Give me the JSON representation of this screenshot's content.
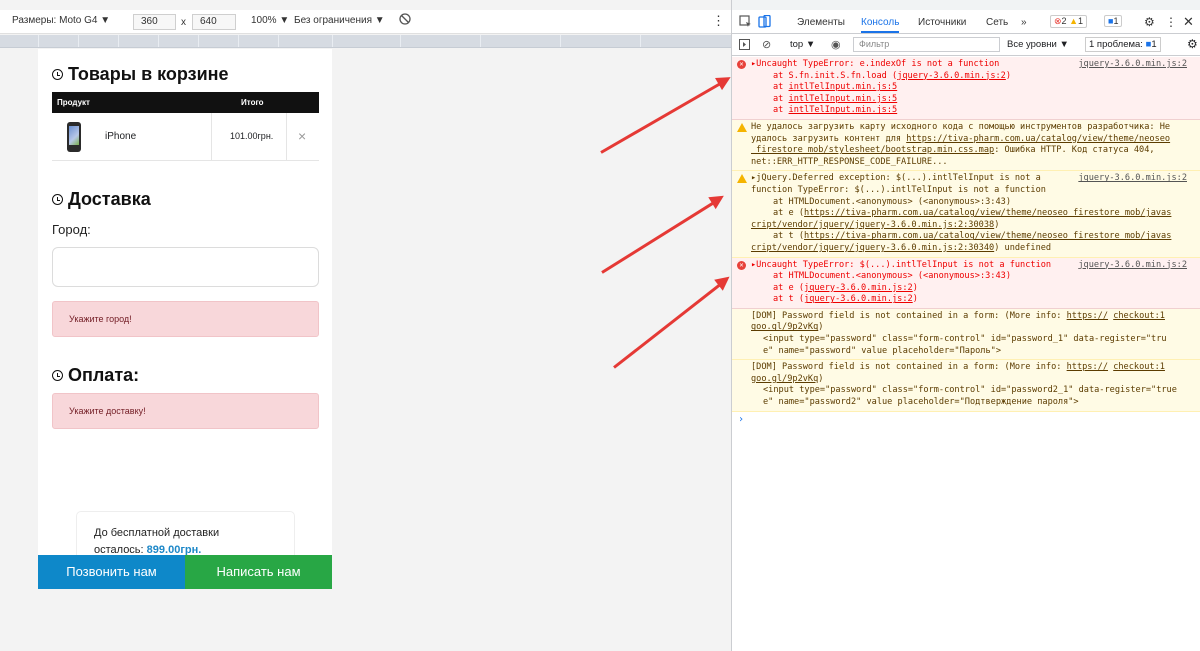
{
  "devbar": {
    "device": "Размеры: Moto G4 ▼",
    "width": "360",
    "x": "x",
    "height": "640",
    "zoom": "100% ▼",
    "throttle": "Без ограничения ▼",
    "kebab": "⋮"
  },
  "page": {
    "cart_title": "Товары в корзине",
    "col_product": "Продукт",
    "col_total": "Итого",
    "item_name": "iPhone",
    "item_price": "101.00грн.",
    "remove": "×",
    "delivery_title": "Доставка",
    "city_label": "Город:",
    "city_alert": "Укажите город!",
    "payment_title": "Оплата:",
    "delivery_alert": "Укажите доставку!",
    "free_line1": "До бесплатной доставки",
    "free_line2_prefix": "осталось:",
    "free_amount": "899.00грн.",
    "call_btn": "Позвонить нам",
    "write_btn": "Написать нам"
  },
  "devtools": {
    "tabs": [
      "Элементы",
      "Консоль",
      "Источники",
      "Сеть",
      "»"
    ],
    "errors_count": "2",
    "warnings_count": "1",
    "info_count": "1",
    "context": "top ▼",
    "filter_placeholder": "Фильтр",
    "levels": "Все уровни ▼",
    "issues": "1 проблема:",
    "issues_count": "1"
  },
  "console": {
    "m1": {
      "head": "▸Uncaught TypeError: e.indexOf is not a function",
      "src": "jquery-3.6.0.min.js:2",
      "l1a": "at S.fn.init.S.fn.load (",
      "l1b": "jquery-3.6.0.min.js:2",
      "l1c": ")",
      "l2": "intlTelInput.min.js:5",
      "l3": "intlTelInput.min.js:5",
      "l4": "intlTelInput.min.js:5",
      "at": "at "
    },
    "m2": {
      "l1": "Не удалось загрузить карту исходного кода с помощью инструментов разработчика: Не",
      "l2a": "удалось загрузить контент для ",
      "l2b": "https://tiva-pharm.com.ua/catalog/view/theme/neoseo",
      "l3a": "_firestore_mob/stylesheet/bootstrap.min.css.map",
      "l3b": ": Ошибка HTTP. Код статуса 404,",
      "l4": "net::ERR_HTTP_RESPONSE_CODE_FAILURE..."
    },
    "m3": {
      "head": "▸jQuery.Deferred exception: $(...).intlTelInput is not a",
      "src": "jquery-3.6.0.min.js:2",
      "l1": "function TypeError: $(...).intlTelInput is not a function",
      "l2": "at HTMLDocument.<anonymous> (<anonymous>:3:43)",
      "l3a": "at e (",
      "l3b": "https://tiva-pharm.com.ua/catalog/view/theme/neoseo_firestore_mob/javas",
      "l4": "cript/vendor/jquery/jquery-3.6.0.min.js:2:30038",
      "l4c": ")",
      "l5a": "at t (",
      "l5b": "https://tiva-pharm.com.ua/catalog/view/theme/neoseo_firestore_mob/javas",
      "l6": "cript/vendor/jquery/jquery-3.6.0.min.js:2:30340",
      "l6c": ") undefined"
    },
    "m4": {
      "head": "▸Uncaught TypeError: $(...).intlTelInput is not a function",
      "src": "jquery-3.6.0.min.js:2",
      "l1": "at HTMLDocument.<anonymous> (<anonymous>:3:43)",
      "l2a": "at e (",
      "l2b": "jquery-3.6.0.min.js:2",
      "l2c": ")",
      "l3a": "at t (",
      "l3b": "jquery-3.6.0.min.js:2",
      "l3c": ")"
    },
    "m5": {
      "l1a": "[DOM] Password field is not contained in a form: (More info: ",
      "l1b": "https://",
      "l1c": " ",
      "l1d": "checkout:1",
      "l2": "goo.gl/9p2vKq",
      "l2c": ")",
      "l3": "<input type=\"password\" class=\"form-control\" id=\"password_1\" data-register=\"tru",
      "l4": "e\" name=\"password\" value placeholder=\"Пароль\">"
    },
    "m6": {
      "l1a": "[DOM] Password field is not contained in a form: (More info: ",
      "l1b": "https://",
      "l1c": " ",
      "l1d": "checkout:1",
      "l2": "goo.gl/9p2vKq",
      "l2c": ")",
      "l3": "<input type=\"password\" class=\"form-control\" id=\"password2_1\" data-register=\"true",
      "l4": "e\" name=\"password2\" value placeholder=\"Подтверждение пароля\">"
    },
    "prompt": "›"
  },
  "colors": {
    "call_btn": "#0e88c9",
    "write_btn": "#28a745",
    "arrow": "#e53935",
    "error_bg": "#fff0f0",
    "warn_bg": "#fffbe5"
  }
}
